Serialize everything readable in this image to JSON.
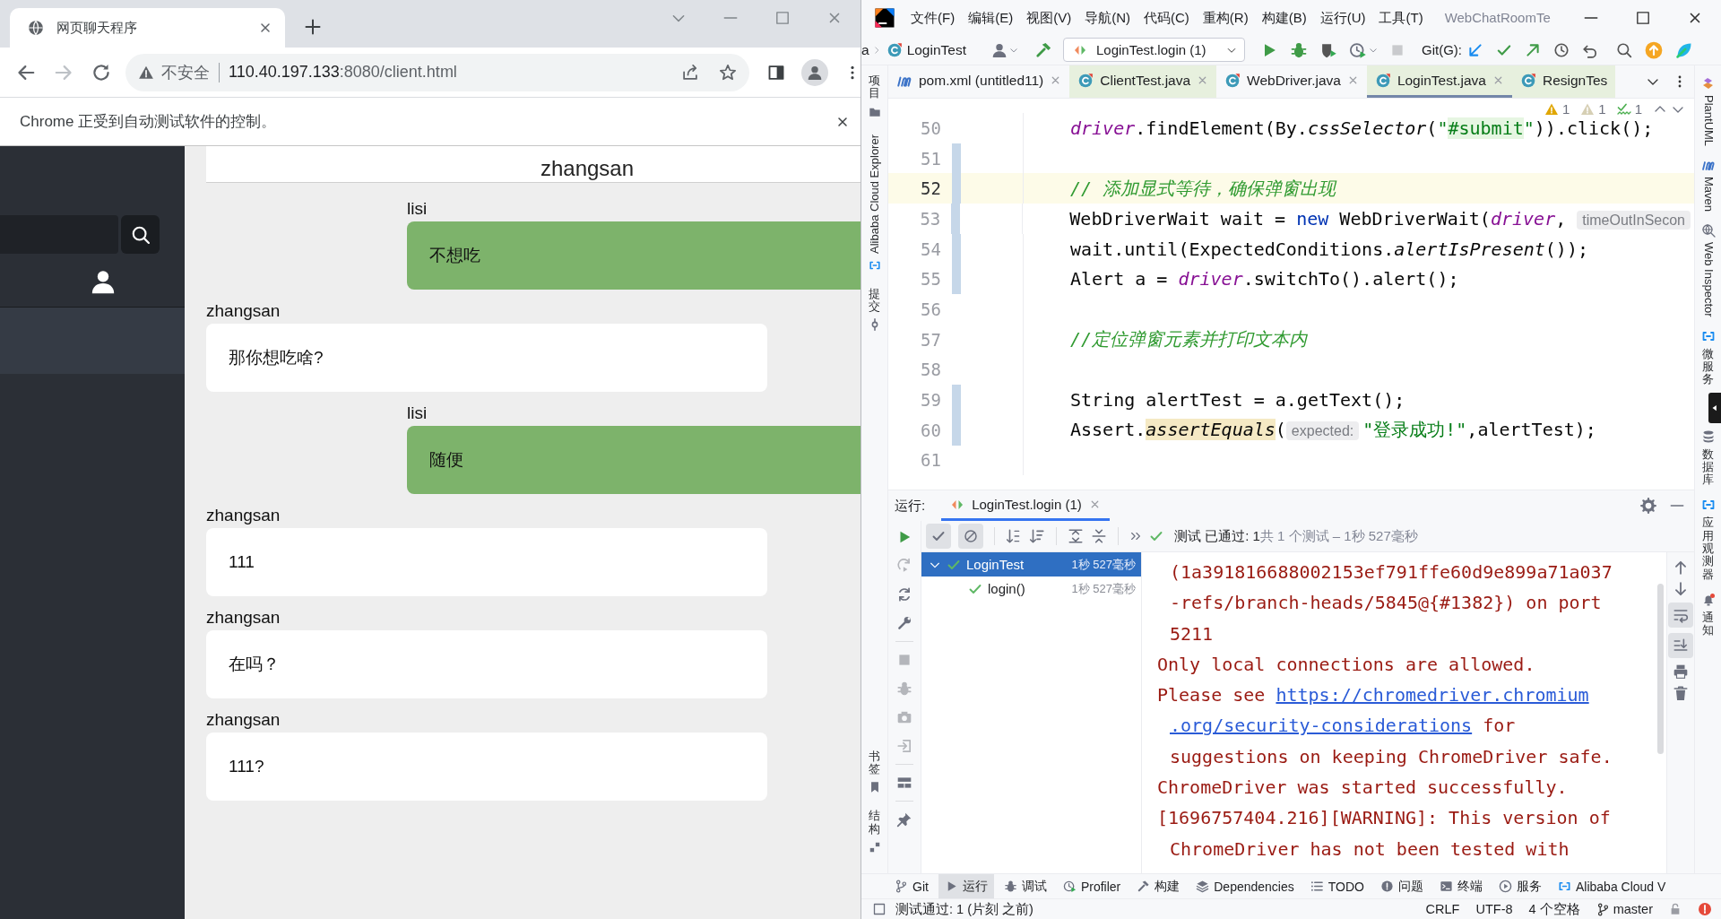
{
  "browser": {
    "tab_title": "网页聊天程序",
    "forward_enabled": false,
    "security_label": "不安全",
    "url": {
      "host": "110.40.197.133",
      "path": ":8080/client.html"
    },
    "infobar": "Chrome 正受到自动测试软件的控制。"
  },
  "chat": {
    "title": "zhangsan",
    "sessions": [
      {
        "selected": true
      }
    ],
    "messages": [
      {
        "sender": "lisi",
        "text": "不想吃",
        "own": true
      },
      {
        "sender": "zhangsan",
        "text": "那你想吃啥?",
        "own": false
      },
      {
        "sender": "lisi",
        "text": "随便",
        "own": true
      },
      {
        "sender": "zhangsan",
        "text": "111",
        "own": false
      },
      {
        "sender": "zhangsan",
        "text": "在吗？",
        "own": false
      },
      {
        "sender": "zhangsan",
        "text": "111?",
        "own": false
      }
    ]
  },
  "ide": {
    "menu": [
      "文件(F)",
      "编辑(E)",
      "视图(V)",
      "导航(N)",
      "代码(C)",
      "重构(R)",
      "构建(B)",
      "运行(U)",
      "工具(T)"
    ],
    "project_title": "WebChatRoomTe",
    "breadcrumb": [
      "a",
      "LoginTest"
    ],
    "run_config": "LoginTest.login (1)",
    "stop_enabled": false,
    "git_label": "Git(G):",
    "left_stripe": {
      "top": [
        {
          "label": "项目",
          "kind": "cjk"
        },
        {
          "label": "Alibaba Cloud Explorer",
          "kind": "latin"
        },
        {
          "label": "提交",
          "kind": "cjk"
        }
      ],
      "bottom": [
        {
          "label": "书签",
          "kind": "cjk"
        },
        {
          "label": "结构",
          "kind": "cjk"
        }
      ]
    },
    "right_stripe": [
      {
        "label": "PlantUML",
        "kind": "latin"
      },
      {
        "label": "Maven",
        "kind": "latin"
      },
      {
        "label": "Web Inspector",
        "kind": "latin"
      },
      {
        "label": "微服务",
        "kind": "cjk"
      },
      {
        "label": "数据库",
        "kind": "cjk"
      },
      {
        "label": "应用观测器",
        "kind": "cjk"
      },
      {
        "label": "通知",
        "kind": "cjk"
      }
    ],
    "tabs": [
      {
        "label": "pom.xml (untitled11)",
        "kind": "maven",
        "selected": false,
        "tinted": false,
        "closable": true
      },
      {
        "label": "ClientTest.java",
        "kind": "class",
        "selected": false,
        "tinted": true,
        "closable": true
      },
      {
        "label": "WebDriver.java",
        "kind": "class",
        "selected": false,
        "tinted": false,
        "closable": true
      },
      {
        "label": "LoginTest.java",
        "kind": "class",
        "selected": true,
        "tinted": true,
        "closable": true
      },
      {
        "label": "ResignTes",
        "kind": "class",
        "selected": false,
        "tinted": true,
        "closable": false
      }
    ],
    "inspections": [
      {
        "kind": "warning",
        "count": "1"
      },
      {
        "kind": "weak",
        "count": "1"
      },
      {
        "kind": "typo",
        "count": "1"
      }
    ],
    "code": [
      {
        "number": "50",
        "changed": false,
        "current": false,
        "tokens": [
          {
            "kind": "field",
            "text": "driver"
          },
          {
            "kind": "plain",
            "text": ".findElement(By."
          },
          {
            "kind": "static",
            "text": "cssSelector"
          },
          {
            "kind": "plain",
            "text": "("
          },
          {
            "kind": "string",
            "text": "\""
          },
          {
            "kind": "match",
            "text": "#submit"
          },
          {
            "kind": "string",
            "text": "\""
          },
          {
            "kind": "plain",
            "text": ")).click();"
          }
        ]
      },
      {
        "number": "51",
        "changed": true,
        "current": false
      },
      {
        "number": "52",
        "changed": true,
        "current": true,
        "tokens": [
          {
            "kind": "comment",
            "text": "// 添加显式等待，确保弹窗出现"
          }
        ]
      },
      {
        "number": "53",
        "changed": true,
        "current": false,
        "tokens": [
          {
            "kind": "plain",
            "text": "WebDriverWait wait = "
          },
          {
            "kind": "keyword",
            "text": "new"
          },
          {
            "kind": "plain",
            "text": " WebDriverWait("
          },
          {
            "kind": "field",
            "text": "driver"
          },
          {
            "kind": "plain",
            "text": ", "
          },
          {
            "kind": "hint",
            "text": "timeOutInSecon"
          }
        ]
      },
      {
        "number": "54",
        "changed": true,
        "current": false,
        "tokens": [
          {
            "kind": "plain",
            "text": "wait.until(ExpectedConditions."
          },
          {
            "kind": "static",
            "text": "alertIsPresent"
          },
          {
            "kind": "plain",
            "text": "());"
          }
        ]
      },
      {
        "number": "55",
        "changed": true,
        "current": false,
        "tokens": [
          {
            "kind": "plain",
            "text": "Alert a = "
          },
          {
            "kind": "field",
            "text": "driver"
          },
          {
            "kind": "plain",
            "text": ".switchTo().alert();"
          }
        ]
      },
      {
        "number": "56",
        "changed": false,
        "current": false
      },
      {
        "number": "57",
        "changed": false,
        "current": false,
        "tokens": [
          {
            "kind": "comment",
            "text": "//定位弹窗元素并打印文本内"
          }
        ]
      },
      {
        "number": "58",
        "changed": false,
        "current": false
      },
      {
        "number": "59",
        "changed": true,
        "current": false,
        "tokens": [
          {
            "kind": "plain",
            "text": "String alertTest = a.getText();"
          }
        ]
      },
      {
        "number": "60",
        "changed": true,
        "current": false,
        "tokens": [
          {
            "kind": "plain",
            "text": "Assert."
          },
          {
            "kind": "usage",
            "text": "assertEquals"
          },
          {
            "kind": "plain",
            "text": "("
          },
          {
            "kind": "hint",
            "text": "expected:"
          },
          {
            "kind": "string",
            "text": "\"登录成功!\""
          },
          {
            "kind": "plain",
            "text": ",alertTest);"
          }
        ]
      },
      {
        "number": "61",
        "changed": false,
        "current": false
      }
    ],
    "run": {
      "title": "运行:",
      "tab": "LoginTest.login (1)",
      "show_passed": true,
      "show_ignored": true,
      "status": "测试 已通过: 1",
      "summary": "共 1 个测试 – 1秒 527毫秒",
      "tree": [
        {
          "name": "LoginTest",
          "time": "1秒 527毫秒",
          "selected": true,
          "expanded": true,
          "passed": true,
          "children": [
            {
              "name": "login()",
              "time": "1秒 527毫秒",
              "selected": false,
              "passed": true
            }
          ]
        }
      ],
      "console": [
        {
          "kind": "wrap",
          "parts": [
            {
              "text": "(1a391816688002153ef791ffe60d9e899a71a037"
            }
          ]
        },
        {
          "kind": "wrap",
          "parts": [
            {
              "text": "-refs/branch-heads/5845@{#1382}) on port"
            }
          ]
        },
        {
          "kind": "wrap",
          "parts": [
            {
              "text": "5211"
            }
          ]
        },
        {
          "kind": "line",
          "parts": [
            {
              "text": "Only local connections are allowed."
            }
          ]
        },
        {
          "kind": "line",
          "parts": [
            {
              "text": "Please see "
            },
            {
              "text": "https://chromedriver.chromium",
              "link": true
            }
          ]
        },
        {
          "kind": "wrap",
          "parts": [
            {
              "text": ".org/security-considerations",
              "link": true
            },
            {
              "text": " for"
            }
          ]
        },
        {
          "kind": "wrap",
          "parts": [
            {
              "text": "suggestions on keeping ChromeDriver safe."
            }
          ]
        },
        {
          "kind": "line",
          "parts": [
            {
              "text": "ChromeDriver was started successfully."
            }
          ]
        },
        {
          "kind": "line",
          "parts": [
            {
              "text": "[1696757404.216][WARNING]: This version of"
            }
          ]
        },
        {
          "kind": "wrap",
          "parts": [
            {
              "text": "ChromeDriver has not been tested with"
            }
          ]
        }
      ],
      "soft_wrap": true,
      "scroll_to_end": true
    },
    "tool_tabs": [
      {
        "label": "Git",
        "selected": false
      },
      {
        "label": "运行",
        "selected": true
      },
      {
        "label": "调试",
        "selected": false
      },
      {
        "label": "Profiler",
        "selected": false
      },
      {
        "label": "构建",
        "selected": false
      },
      {
        "label": "Dependencies",
        "selected": false
      },
      {
        "label": "TODO",
        "selected": false
      },
      {
        "label": "问题",
        "selected": false
      },
      {
        "label": "终端",
        "selected": false
      },
      {
        "label": "服务",
        "selected": false
      },
      {
        "label": "Alibaba Cloud V",
        "selected": false
      }
    ],
    "status": {
      "message": "测试通过: 1 (片刻 之前)",
      "line_separator": "CRLF",
      "encoding": "UTF-8",
      "indent": "4 个空格",
      "branch": "master"
    }
  }
}
